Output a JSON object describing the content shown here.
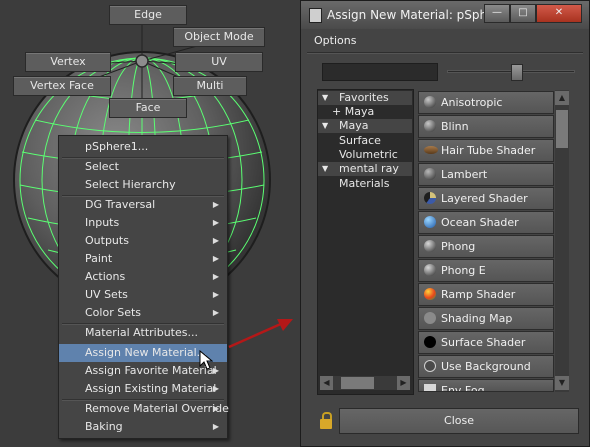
{
  "viewport": {
    "hotbox": {
      "edge": "Edge",
      "object_mode": "Object Mode",
      "vertex": "Vertex",
      "uv": "UV",
      "vertex_face": "Vertex Face",
      "multi": "Multi",
      "face": "Face"
    },
    "context_menu": {
      "object_name": "pSphere1...",
      "items": [
        "Select",
        "Select Hierarchy",
        "DG Traversal",
        "Inputs",
        "Outputs",
        "Paint",
        "Actions",
        "UV Sets",
        "Color Sets",
        "Material Attributes...",
        "Assign New Material...",
        "Assign Favorite Material",
        "Assign Existing Material",
        "Remove Material Override",
        "Baking"
      ],
      "highlighted": "Assign New Material..."
    }
  },
  "dialog": {
    "title": "Assign New Material: pSphe...",
    "options_menu": "Options",
    "search_value": "",
    "slider_fraction": 0.55,
    "tree": {
      "favorites": "Favorites",
      "favorites_maya": "+ Maya",
      "maya": "Maya",
      "surface": "Surface",
      "volumetric": "Volumetric",
      "mental_ray": "mental ray",
      "materials": "Materials"
    },
    "materials": [
      {
        "label": "Anisotropic",
        "icon": "gray-sphere"
      },
      {
        "label": "Blinn",
        "icon": "gray-sphere"
      },
      {
        "label": "Hair Tube Shader",
        "icon": "brown-tube"
      },
      {
        "label": "Lambert",
        "icon": "gray-sphere"
      },
      {
        "label": "Layered Shader",
        "icon": "layered-sphere"
      },
      {
        "label": "Ocean Shader",
        "icon": "ocean-sphere"
      },
      {
        "label": "Phong",
        "icon": "gray-sphere"
      },
      {
        "label": "Phong E",
        "icon": "gray-sphere"
      },
      {
        "label": "Ramp Shader",
        "icon": "ramp-sphere"
      },
      {
        "label": "Shading Map",
        "icon": "gray-flat"
      },
      {
        "label": "Surface Shader",
        "icon": "black-sphere"
      },
      {
        "label": "Use Background",
        "icon": "outline-sphere"
      },
      {
        "label": "Env Fog",
        "icon": "white-square"
      }
    ],
    "close_label": "Close",
    "colors": {
      "highlight": "#5f82ad",
      "wire": "#5bff73"
    }
  }
}
